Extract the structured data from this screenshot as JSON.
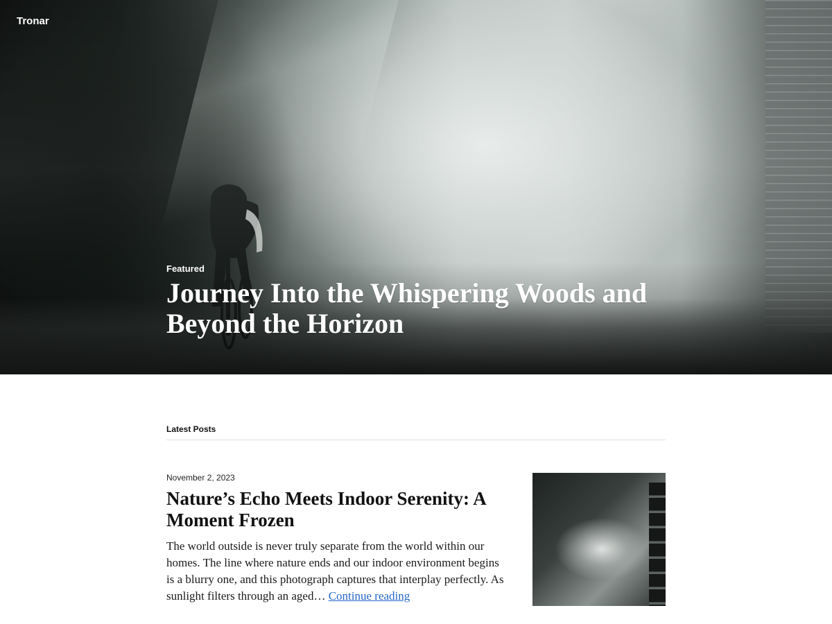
{
  "site": {
    "title": "Tronar"
  },
  "hero": {
    "label": "Featured",
    "title": "Journey Into the Whispering Woods and Beyond the Horizon"
  },
  "latest": {
    "heading": "Latest Posts",
    "posts": [
      {
        "date": "November 2, 2023",
        "title": "Nature’s Echo Meets Indoor Serenity: A Moment Frozen",
        "excerpt": "The world outside is never truly separate from the world within our homes. The line where nature ends and our indoor environment begins is a blurry one, and this photograph captures that interplay perfectly. As sunlight filters through an aged…",
        "continue_label": "Continue reading"
      }
    ]
  },
  "colors": {
    "link": "#2466c8",
    "text": "#1a1a1a",
    "divider": "#e2e2e2"
  }
}
